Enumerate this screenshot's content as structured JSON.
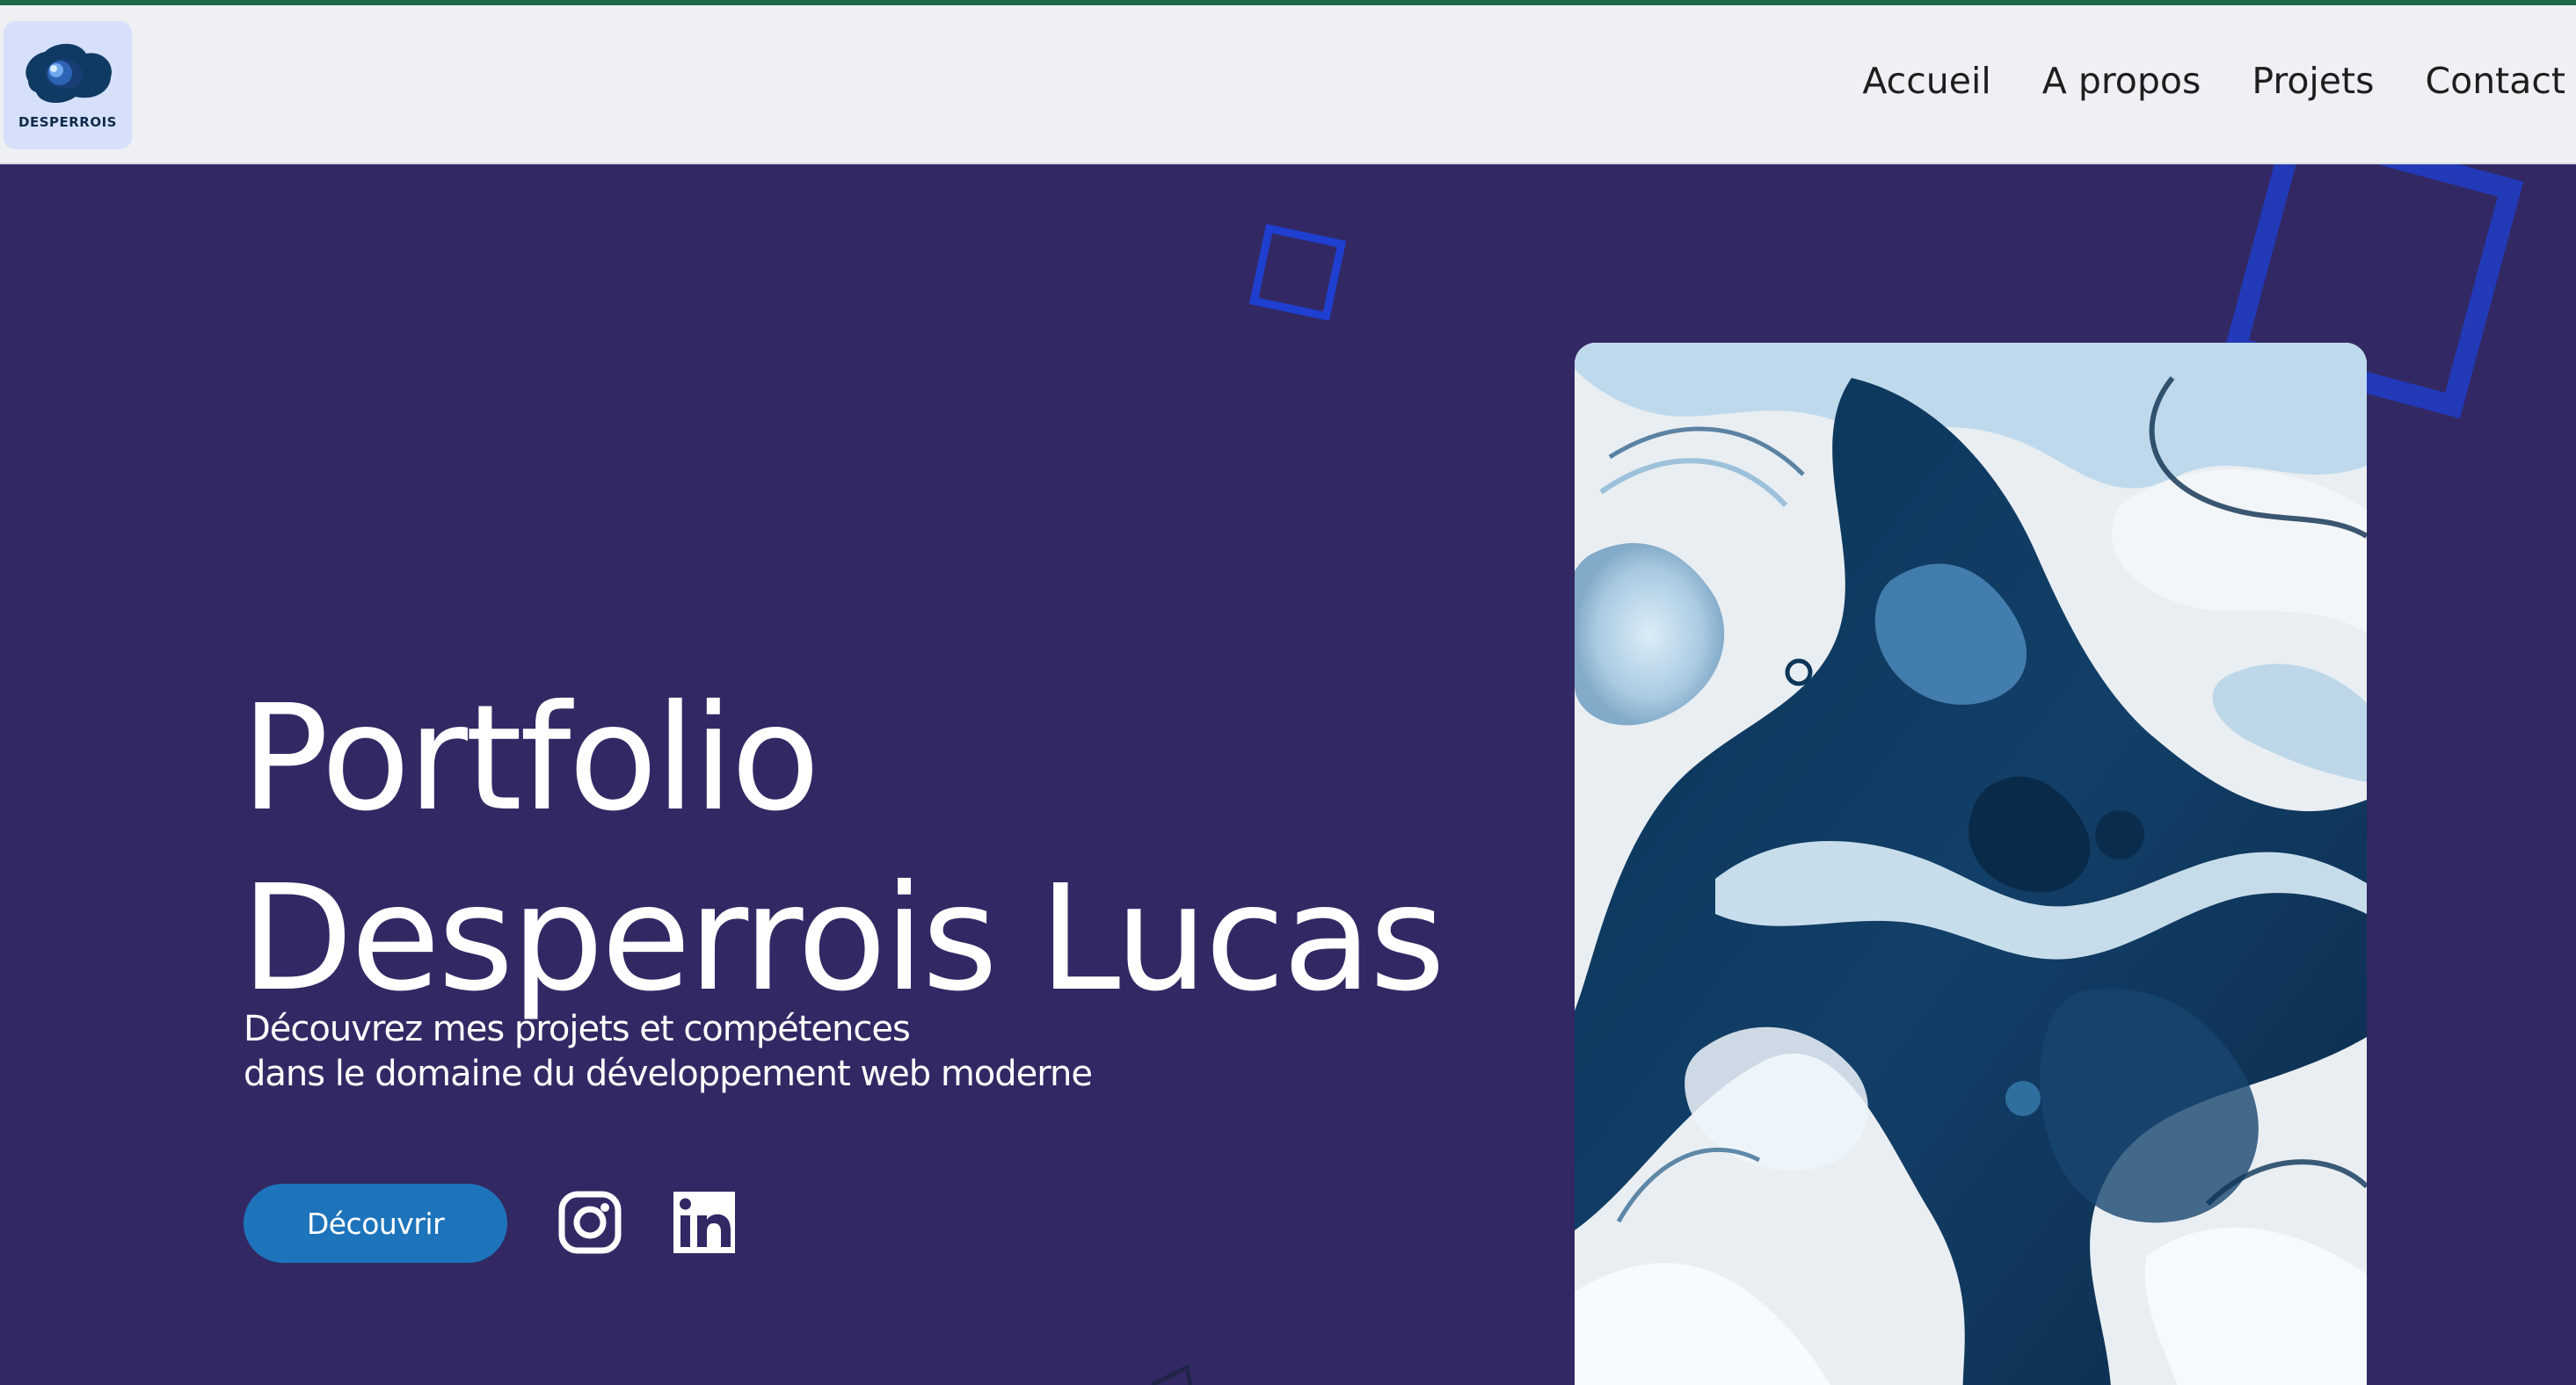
{
  "header": {
    "logo": {
      "text": "DESPERROIS",
      "icon": "blob-logo-icon"
    },
    "nav": [
      {
        "label": "Accueil"
      },
      {
        "label": "A propos"
      },
      {
        "label": "Projets"
      },
      {
        "label": "Contact"
      }
    ]
  },
  "hero": {
    "title_line1": "Portfolio",
    "title_line2": "Desperrois Lucas",
    "subtitle_line1": "Découvrez mes projets et compétences",
    "subtitle_line2": "dans le domaine du développement web moderne",
    "cta_label": "Découvrir",
    "social_icons": [
      "instagram-icon",
      "linkedin-icon"
    ],
    "image_description_icon": "marble-abstract-image"
  },
  "colors": {
    "background": "#322964",
    "header_bg": "#eef0f3",
    "accent_line": "#1c6a45",
    "button": "#1d74bb",
    "decor_blue": "#1e3fd0"
  }
}
